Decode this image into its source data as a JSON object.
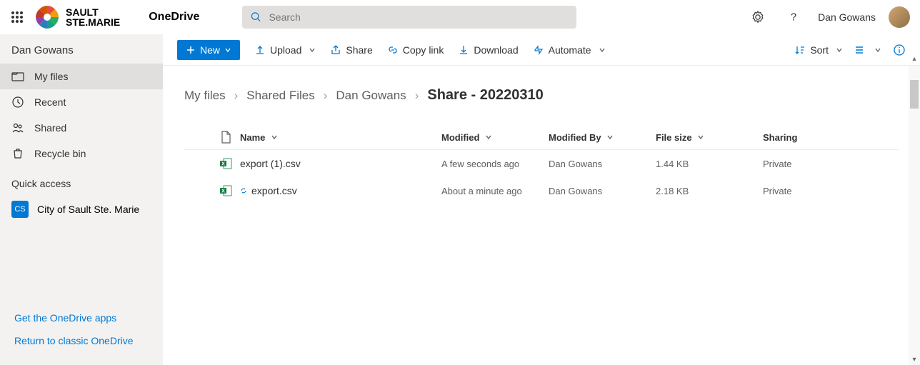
{
  "header": {
    "app_name": "OneDrive",
    "logo_text_line1": "SAULT",
    "logo_text_line2": "STE.MARIE",
    "search_placeholder": "Search",
    "user_name": "Dan Gowans"
  },
  "sidebar": {
    "user": "Dan Gowans",
    "nav": [
      {
        "label": "My files",
        "active": true
      },
      {
        "label": "Recent",
        "active": false
      },
      {
        "label": "Shared",
        "active": false
      },
      {
        "label": "Recycle bin",
        "active": false
      }
    ],
    "quick_access_header": "Quick access",
    "quick_access": [
      {
        "badge": "CS",
        "label": "City of Sault Ste. Marie"
      }
    ],
    "footer_links": [
      "Get the OneDrive apps",
      "Return to classic OneDrive"
    ]
  },
  "command_bar": {
    "new_label": "New",
    "items": [
      "Upload",
      "Share",
      "Copy link",
      "Download",
      "Automate"
    ],
    "sort_label": "Sort"
  },
  "breadcrumb": {
    "items": [
      "My files",
      "Shared Files",
      "Dan Gowans"
    ],
    "current": "Share - 20220310"
  },
  "table": {
    "columns": [
      "Name",
      "Modified",
      "Modified By",
      "File size",
      "Sharing"
    ],
    "rows": [
      {
        "name": "export (1).csv",
        "modified": "A few seconds ago",
        "modified_by": "Dan Gowans",
        "size": "1.44 KB",
        "sharing": "Private"
      },
      {
        "name": "export.csv",
        "modified": "About a minute ago",
        "modified_by": "Dan Gowans",
        "size": "2.18 KB",
        "sharing": "Private"
      }
    ]
  }
}
